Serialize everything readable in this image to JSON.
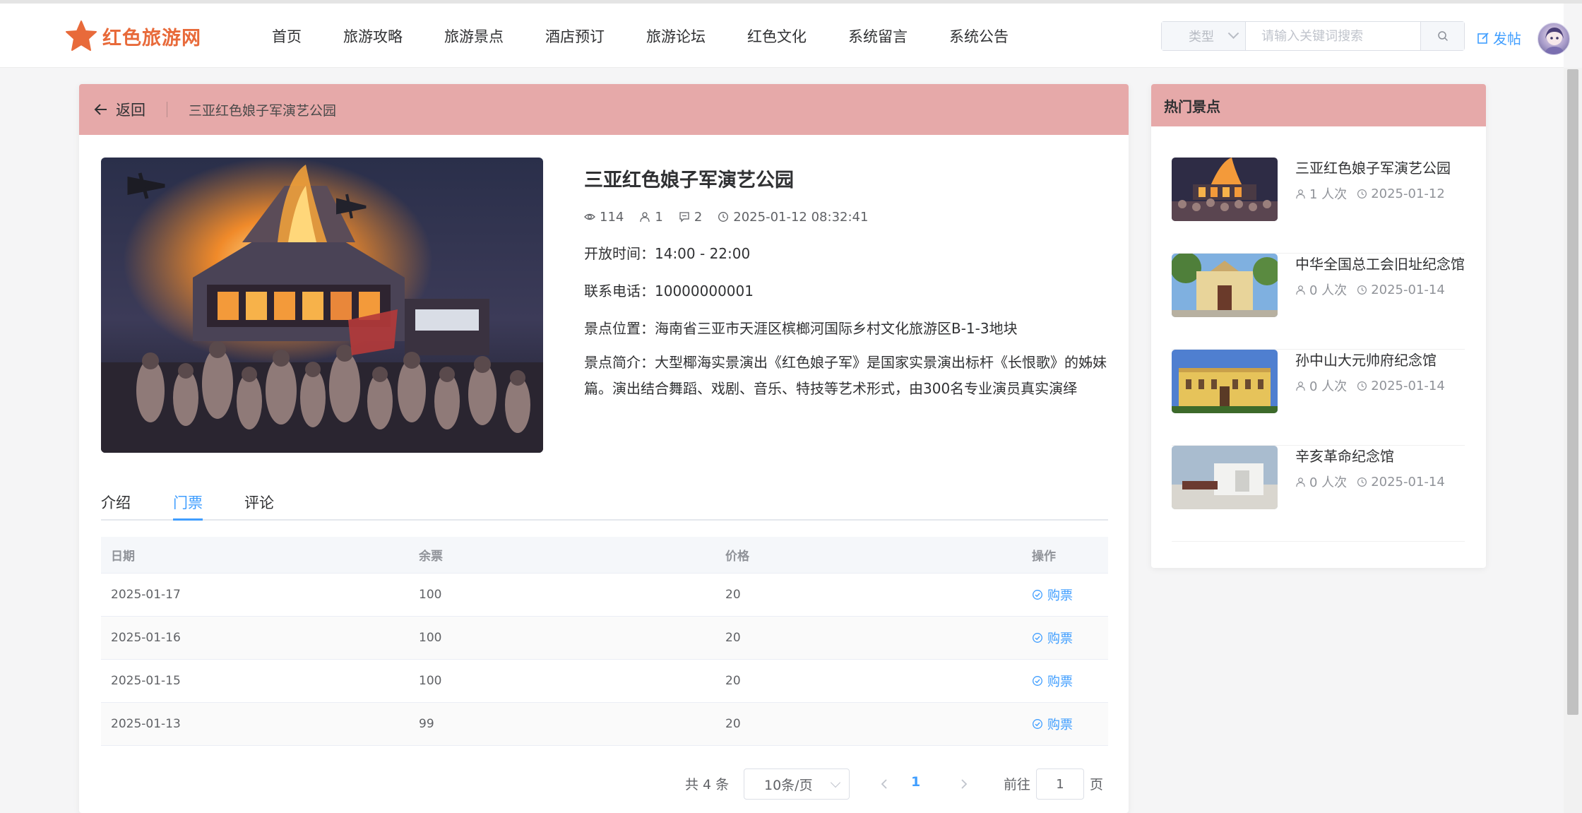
{
  "brand": {
    "name": "红色旅游网",
    "color": "#e86a3a"
  },
  "nav": {
    "items": [
      "首页",
      "旅游攻略",
      "旅游景点",
      "酒店预订",
      "旅游论坛",
      "红色文化",
      "系统留言",
      "系统公告"
    ]
  },
  "search": {
    "type_label": "类型",
    "placeholder": "请输入关键词搜索",
    "icon": "search-icon"
  },
  "post_label": "发帖",
  "header": {
    "back_label": "返回",
    "title": "三亚红色娘子军演艺公园"
  },
  "spot": {
    "title": "三亚红色娘子军演艺公园",
    "views": "114",
    "likes": "1",
    "comments": "2",
    "datetime": "2025-01-12 08:32:41",
    "open_time": "开放时间：14:00 - 22:00",
    "phone": "联系电话：10000000001",
    "location": "景点位置：海南省三亚市天涯区槟榔河国际乡村文化旅游区B-1-3地块",
    "intro": "景点简介：大型椰海实景演出《红色娘子军》是国家实景演出标杆《长恨歌》的姊妹篇。演出结合舞蹈、戏剧、音乐、特技等艺术形式，由300名专业演员真实演绎"
  },
  "tabs": [
    {
      "label": "介绍",
      "active": false
    },
    {
      "label": "门票",
      "active": true
    },
    {
      "label": "评论",
      "active": false
    }
  ],
  "ticket_table": {
    "columns": [
      "日期",
      "余票",
      "价格",
      "操作"
    ],
    "rows": [
      {
        "date": "2025-01-17",
        "remaining": "100",
        "price": "20",
        "action": "购票"
      },
      {
        "date": "2025-01-16",
        "remaining": "100",
        "price": "20",
        "action": "购票"
      },
      {
        "date": "2025-01-15",
        "remaining": "100",
        "price": "20",
        "action": "购票"
      },
      {
        "date": "2025-01-13",
        "remaining": "99",
        "price": "20",
        "action": "购票"
      }
    ]
  },
  "pagination": {
    "total": "共 4 条",
    "page_size": "10条/页",
    "current_page": "1",
    "goto_label": "前往",
    "goto_value": "1",
    "page_suffix": "页"
  },
  "sidebar": {
    "title": "热门景点",
    "items": [
      {
        "title": "三亚红色娘子军演艺公园",
        "visits": "1 人次",
        "date": "2025-01-12"
      },
      {
        "title": "中华全国总工会旧址纪念馆",
        "visits": "0 人次",
        "date": "2025-01-14"
      },
      {
        "title": "孙中山大元帅府纪念馆",
        "visits": "0 人次",
        "date": "2025-01-14"
      },
      {
        "title": "辛亥革命纪念馆",
        "visits": "0 人次",
        "date": "2025-01-14"
      }
    ]
  },
  "colors": {
    "accent": "#409eff",
    "header_pink": "#e6a9a9"
  }
}
